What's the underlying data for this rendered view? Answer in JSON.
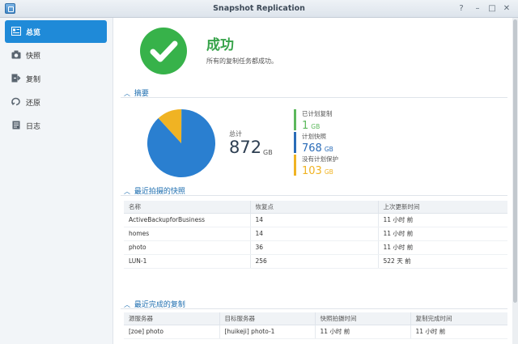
{
  "window": {
    "title": "Snapshot Replication",
    "help": "?",
    "minimize": "–",
    "maximize": "□",
    "close": "✕"
  },
  "sidebar": {
    "items": [
      {
        "label": "总览",
        "icon": "overview-icon"
      },
      {
        "label": "快照",
        "icon": "camera-icon"
      },
      {
        "label": "复制",
        "icon": "replication-icon"
      },
      {
        "label": "还原",
        "icon": "restore-icon"
      },
      {
        "label": "日志",
        "icon": "log-icon"
      }
    ]
  },
  "status": {
    "title": "成功",
    "description": "所有的复制任务都成功。"
  },
  "summary": {
    "heading": "摘要",
    "total_label": "总计",
    "total_value": "872",
    "total_unit": "GB",
    "legend": [
      {
        "label": "已计划复制",
        "value": "1",
        "unit": "GB",
        "color": "#5cb85c"
      },
      {
        "label": "计划快照",
        "value": "768",
        "unit": "GB",
        "color": "#2a6cb8"
      },
      {
        "label": "没有计划保护",
        "value": "103",
        "unit": "GB",
        "color": "#f0b323"
      }
    ]
  },
  "chart_data": {
    "type": "pie",
    "unit": "GB",
    "slices": [
      {
        "name": "已计划复制",
        "value": 1,
        "color": "#5cb85c"
      },
      {
        "name": "计划快照",
        "value": 768,
        "color": "#2a7fd0"
      },
      {
        "name": "没有计划保护",
        "value": 103,
        "color": "#f0b323"
      }
    ]
  },
  "snapshots": {
    "heading": "最近拍摄的快照",
    "columns": [
      "名称",
      "恢复点",
      "上次更新时间"
    ],
    "rows": [
      [
        "ActiveBackupforBusiness",
        "14",
        "11 小时 前"
      ],
      [
        "homes",
        "14",
        "11 小时 前"
      ],
      [
        "photo",
        "36",
        "11 小时 前"
      ],
      [
        "LUN-1",
        "256",
        "522 天 前"
      ]
    ]
  },
  "replications": {
    "heading": "最近完成的复制",
    "columns": [
      "源服务器",
      "目标服务器",
      "快照拍摄时间",
      "复制完成时间"
    ],
    "rows": [
      [
        "[zoe] photo",
        "[huikeji] photo-1",
        "11 小时 前",
        "11 小时 前"
      ]
    ]
  }
}
